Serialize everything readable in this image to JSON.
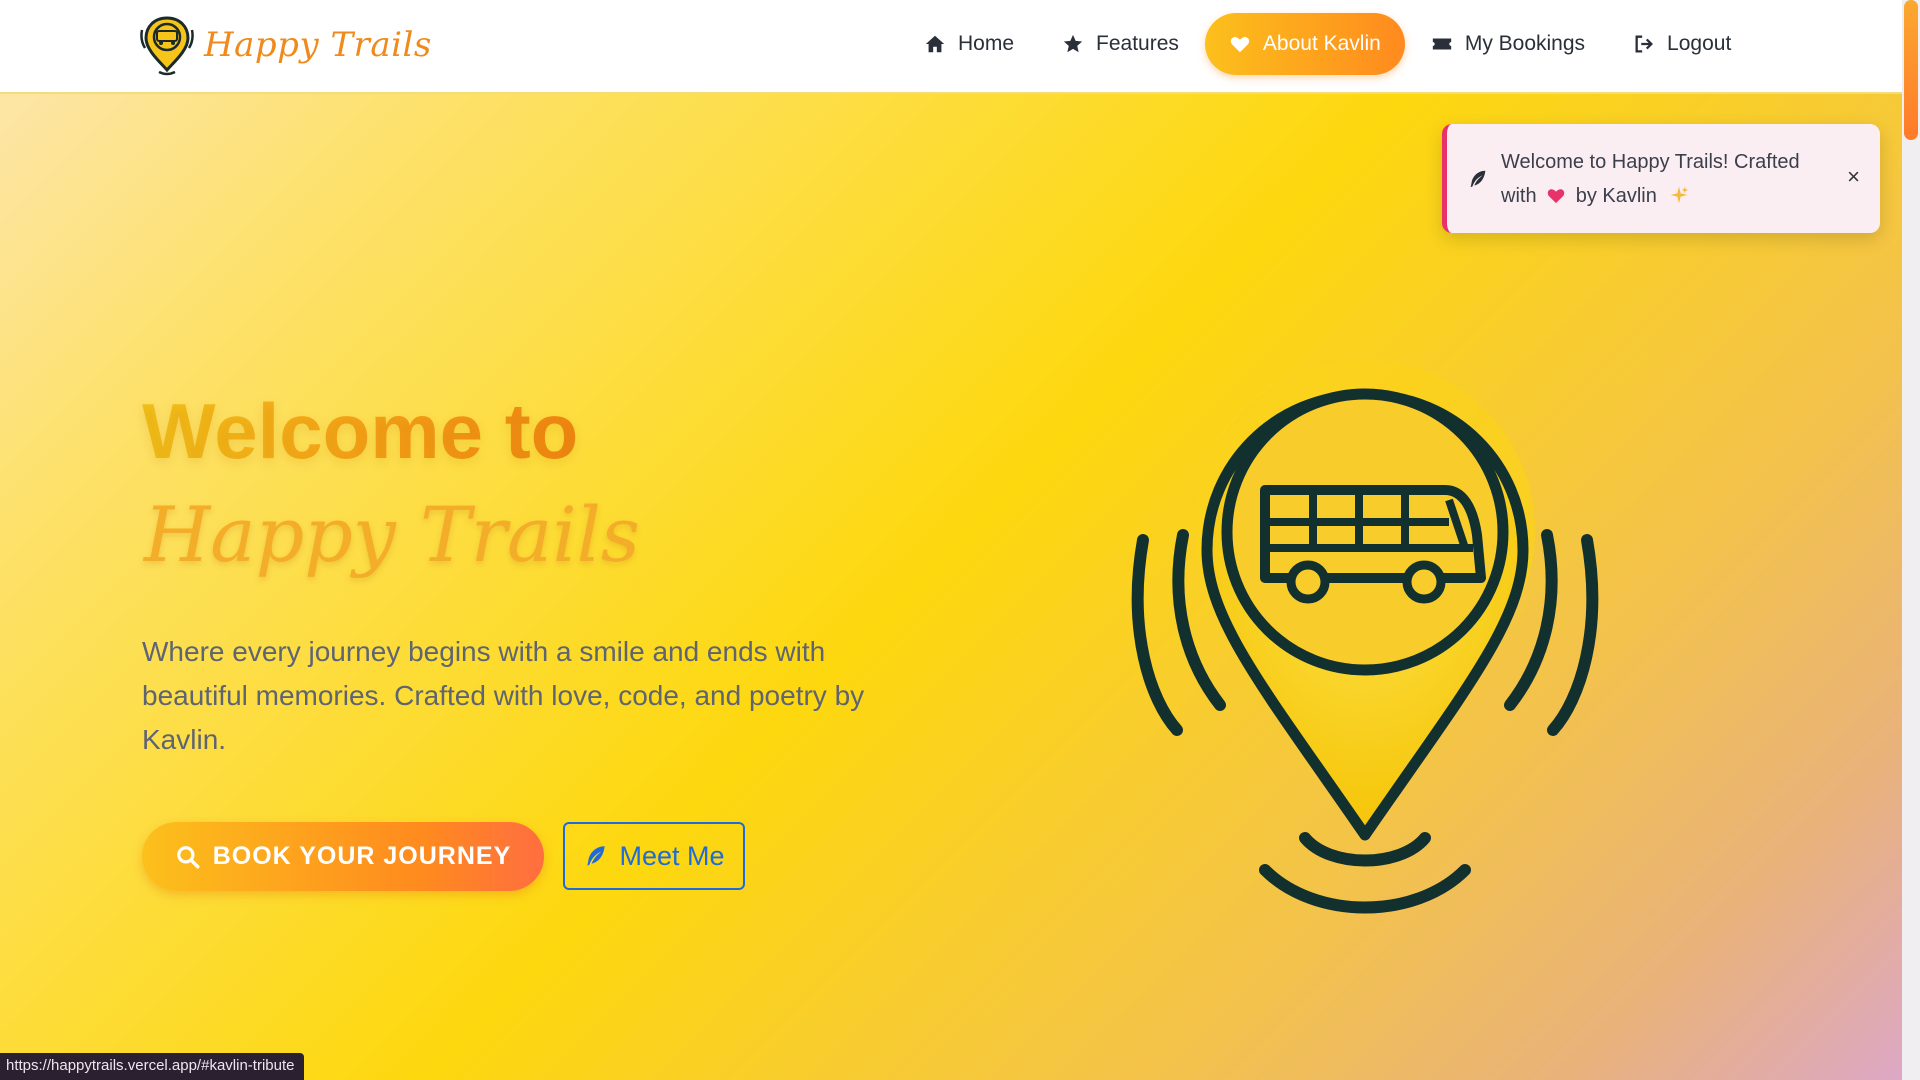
{
  "brand": {
    "name": "Happy Trails",
    "logo_icon": "bus-location-pin-icon"
  },
  "nav": {
    "items": [
      {
        "label": "Home",
        "icon": "home-icon"
      },
      {
        "label": "Features",
        "icon": "star-icon"
      },
      {
        "label": "About Kavlin",
        "icon": "heart-icon",
        "active": true
      },
      {
        "label": "My Bookings",
        "icon": "ticket-icon"
      },
      {
        "label": "Logout",
        "icon": "logout-icon"
      }
    ]
  },
  "toast": {
    "icon": "feather-icon",
    "line1": "Welcome to Happy Trails! Crafted",
    "line2_prefix": "with",
    "line2_suffix": "by Kavlin",
    "close_label": "×"
  },
  "hero": {
    "title": "Welcome to",
    "script_title": "Happy Trails",
    "subtitle": "Where every journey begins with a smile and ends with beautiful memories. Crafted with love, code, and poetry by Kavlin.",
    "book_button": "BOOK YOUR JOURNEY",
    "meet_button": "Meet Me",
    "illustration": "bus-location-pin-icon"
  },
  "status_bar": {
    "url": "https://happytrails.vercel.app/#kavlin-tribute"
  },
  "colors": {
    "accent_start": "#fcc01c",
    "accent_end": "#ff8a1e",
    "toast_border": "#e8336a",
    "link_blue": "#1f6bd9",
    "nav_text": "#2b2f3a"
  }
}
